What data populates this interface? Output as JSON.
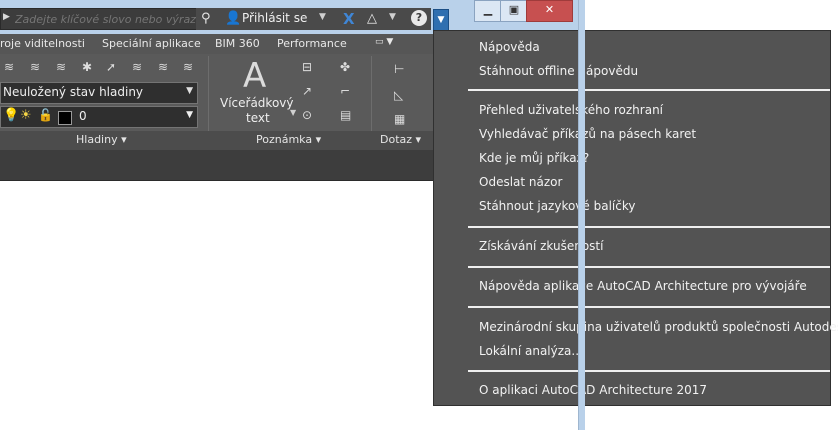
{
  "search": {
    "placeholder": "Zadejte klíčové slovo nebo výraz."
  },
  "toolbar": {
    "signin_label": "Přihlásit se"
  },
  "ribbon": {
    "tabs": [
      "roje viditelnosti",
      "Speciální aplikace",
      "BIM 360",
      "Performance"
    ],
    "layer_state": "Neuložený stav hladiny",
    "layer_current": "0",
    "mtext_label_line1": "Víceřádkový",
    "mtext_label_line2": "text",
    "mtext_glyph": "A",
    "panels": [
      "Hladiny",
      "Poznámka",
      "Dotaz"
    ]
  },
  "help_menu": {
    "items": [
      "Nápověda",
      "Stáhnout offline nápovědu",
      "Přehled uživatelského rozhraní",
      "Vyhledávač příkazů na pásech karet",
      "Kde je můj příkaz?",
      "Odeslat názor",
      "Stáhnout jazykové balíčky",
      "Získávání zkušeností",
      "Nápověda aplikace AutoCAD Architecture pro vývojáře",
      "Mezinárodní skupina uživatelů produktů společnosti Autodesk",
      "Lokální analýza...",
      "O aplikaci AutoCAD Architecture 2017"
    ]
  },
  "colors": {
    "accent": "#2f6fb0",
    "menu_bg": "#535353",
    "ribbon_bg": "#5a5a5a"
  }
}
